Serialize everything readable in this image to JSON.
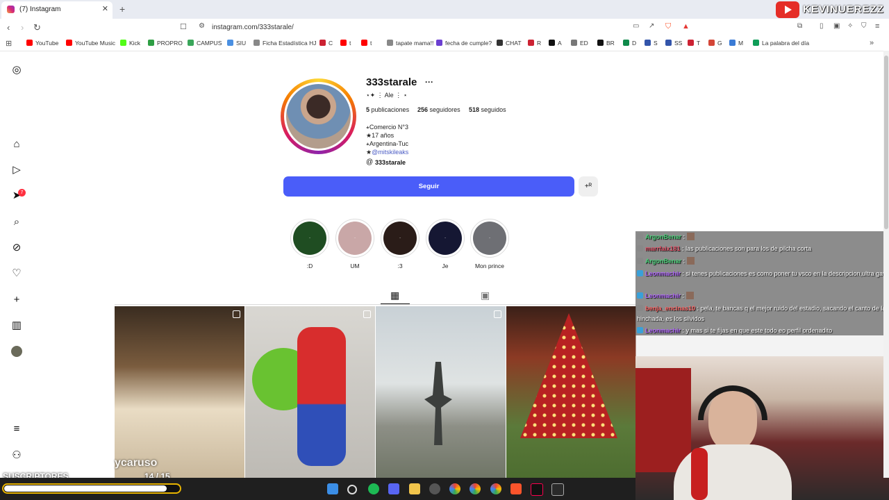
{
  "browser": {
    "tab_title": "(7) Instagram",
    "new_tab": "+",
    "close": "✕",
    "url": "instagram.com/333starale/",
    "streamer_overlay": "KEVINUEREZZ",
    "bookmarks": [
      "YouTube",
      "YouTube Music",
      "Kick",
      "PROPRO",
      "CAMPUS",
      "SIU",
      "Ficha Estadística HJ",
      "C",
      "t",
      "t",
      "tapate mama!!",
      "fecha de cumple?",
      "CHAT",
      "R",
      "A",
      "ED",
      "BR",
      "D",
      "S",
      "SS",
      "T",
      "G",
      "M",
      "La palabra del día"
    ]
  },
  "sidebar": {
    "notifications_count": "7"
  },
  "profile": {
    "username": "333starale",
    "more": "···",
    "display_name": "⋆✦ ⋮ Ale ⋮ ⋆",
    "posts_count": "5",
    "posts_label": "publicaciones",
    "followers_count": "256",
    "followers_label": "seguidores",
    "following_count": "518",
    "following_label": "seguidos",
    "bio": [
      "⭒Comercio N°3",
      "★17 años",
      "⭒Argentina-Tuc"
    ],
    "bio_link": "@mitskileaks",
    "bio_link_prefix": "★",
    "threads_handle": "333starale",
    "follow_label": "Seguir",
    "suggest_icon": "+ᴿ"
  },
  "highlights": [
    {
      "label": ":D",
      "color": "#1f4d22"
    },
    {
      "label": "UM",
      "color": "#c9a7a7"
    },
    {
      "label": ":3",
      "color": "#2a1c18"
    },
    {
      "label": "Je",
      "color": "#151733"
    },
    {
      "label": "Mon prince",
      "color": "#6e6f74"
    }
  ],
  "overlay": {
    "name": "ycaruso",
    "subs_label": "SUSCRIPTORES",
    "subs_current": "14",
    "subs_goal": "15",
    "subs_count": "14 / 15",
    "subs_fraction": 0.93
  },
  "chat": [
    {
      "user": "ArgonBenar",
      "user_color": "#4cd07a",
      "msg": "",
      "emote": true
    },
    {
      "user": "marrfaix181",
      "user_color": "#e0556a",
      "msg": "las publicaciones son para los de pilcha corta"
    },
    {
      "user": "ArgonBenar",
      "user_color": "#4cd07a",
      "msg": "",
      "emote": true
    },
    {
      "user": "Leonmachir",
      "user_color": "#b46bff",
      "msg": "si tenes publicaciones es como poner tu vsco en la descripcion,ultra gay",
      "badge": true
    },
    {
      "user": "Leonmachir",
      "user_color": "#b46bff",
      "msg": "",
      "emote": true,
      "badge": true
    },
    {
      "user": "benja_encinas10",
      "user_color": "#ff6b6b",
      "msg": "pela, te bancas q el mejor ruido del estadio, sacando el canto de la hinchada, es los silvidos"
    },
    {
      "user": "Leonmachir",
      "user_color": "#b46bff",
      "msg": "y mas si te fijas en que este todo eo perfil ordenadito",
      "badge": true
    }
  ]
}
